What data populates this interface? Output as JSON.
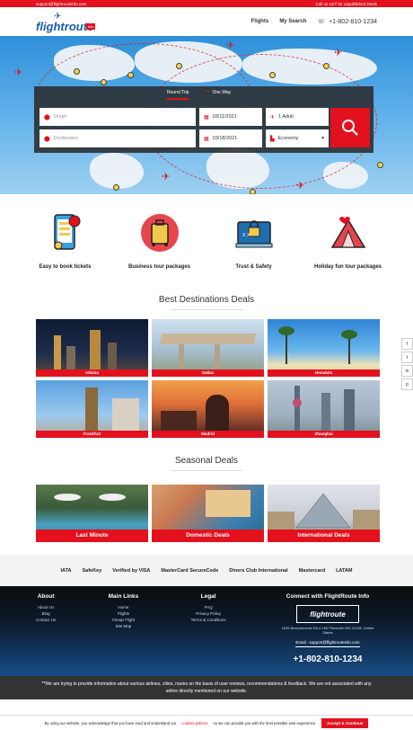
{
  "topbar": {
    "email": "support@flightrouteinfo.com",
    "call": "Call us 24/7 for unpublished Deals"
  },
  "header": {
    "logo": "flightroute",
    "logo_sub": "info",
    "nav": [
      "Flights",
      "My Search"
    ],
    "phone": "+1-802-810-1234"
  },
  "search": {
    "tabs": [
      "Round Trip",
      "One Way"
    ],
    "origin_placeholder": "Origin",
    "destination_placeholder": "Destination",
    "depart_date": "03/11/2021",
    "return_date": "03/18/2021",
    "travellers": "1 Adult",
    "cabin": "Economy"
  },
  "features": [
    {
      "label": "Easy to book tickets"
    },
    {
      "label": "Business tour packages"
    },
    {
      "label": "Trust & Safety"
    },
    {
      "label": "Holiday fun tour packages"
    }
  ],
  "destinations": {
    "title": "Best Destinations Deals",
    "items": [
      "Atlanta",
      "Dallas",
      "Honolulu",
      "Frankfurt",
      "Madrid",
      "Shanghai"
    ]
  },
  "seasonal": {
    "title": "Seasonal Deals",
    "items": [
      "Last Minute",
      "Domestic Deals",
      "International Deals"
    ]
  },
  "badges": [
    "IATA",
    "SafeKey",
    "Verified by VISA",
    "MasterCard SecureCode",
    "Diners Club International",
    "Mastercard",
    "",
    "LATAM"
  ],
  "footer": {
    "about": {
      "title": "About",
      "links": [
        "About Us",
        "Blog",
        "Contact Us"
      ]
    },
    "main": {
      "title": "Main Links",
      "links": [
        "Home",
        "Flights",
        "Cheap Flight",
        "Site Map"
      ]
    },
    "legal": {
      "title": "Legal",
      "links": [
        "FAQ",
        "Privacy Policy",
        "Terms & Conditions"
      ]
    },
    "connect": {
      "title": "Connect with FlightRoute Info",
      "logo": "flightroute",
      "address": "1626 Beachamvain Rd # 160 Pikesville MD 21208, United States",
      "email": "Email : support@flightrouteinfo.com",
      "phone": "+1-802-810-1234"
    }
  },
  "disclaimer": "**We are trying to provide information about various airlines, cities, routes on the basis of user reviews, recommendations & feedback. We are not associated with any airline directly mentioned on our website.",
  "cookie": {
    "text_pre": "By using our website, you acknowledge that you have read and understand our",
    "link": "cookies policies",
    "text_post": "so we can provide you with the best possible web experience.",
    "button": "Accept & Continue"
  },
  "social": [
    "f",
    "t",
    "in",
    "p"
  ],
  "colors": {
    "accent": "#e3111e",
    "brand": "#1a5ca8"
  }
}
